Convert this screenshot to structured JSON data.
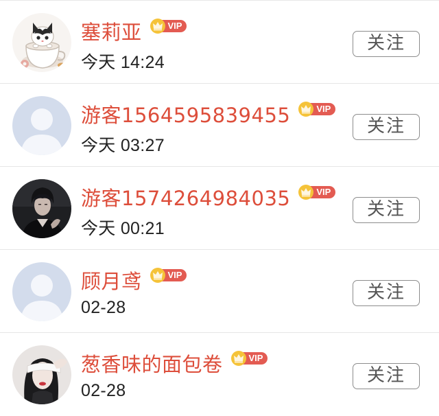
{
  "follow_label": "关注",
  "vip_label": "VIP",
  "users": [
    {
      "name": "塞莉亚",
      "time": "今天 14:24",
      "vip": true,
      "avatar": "cat-in-cup-avatar"
    },
    {
      "name": "游客1564595839455",
      "time": "今天 03:27",
      "vip": true,
      "avatar": "default-avatar"
    },
    {
      "name": "游客1574264984035",
      "time": "今天 00:21",
      "vip": true,
      "avatar": "dark-portrait-avatar"
    },
    {
      "name": "顾月鸢",
      "time": "02-28",
      "vip": true,
      "avatar": "default-avatar"
    },
    {
      "name": "葱香味的面包卷",
      "time": "02-28",
      "vip": true,
      "avatar": "blindfold-portrait-avatar"
    }
  ],
  "colors": {
    "name": "#dd4e3b",
    "vip_badge": "#e35b52",
    "vip_crown": "#f5c339",
    "button_border": "#8c8c8c"
  }
}
